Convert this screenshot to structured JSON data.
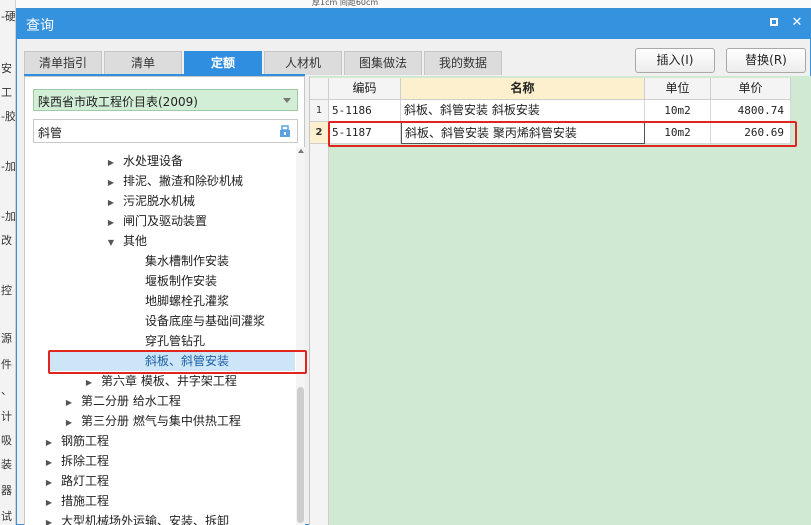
{
  "background": {
    "top_text": "厚1cm 间距60cm",
    "left_fragments": [
      "-硬",
      "安",
      "工",
      "-胶",
      "-加",
      "-加",
      "改",
      "控",
      "源",
      "件",
      "、",
      "计",
      "吸",
      "装",
      "器",
      "试"
    ]
  },
  "dialog": {
    "title": "查询",
    "tabs": [
      "清单指引",
      "清单",
      "定额",
      "人材机",
      "图集做法",
      "我的数据"
    ],
    "active_tab": "定额",
    "buttons": {
      "insert": "插入(I)",
      "replace": "替换(R)"
    }
  },
  "left": {
    "library": "陕西省市政工程价目表(2009)",
    "search_value": "斜管",
    "tree": [
      {
        "label": "水处理设备",
        "toggle": "▶"
      },
      {
        "label": "排泥、撇渣和除砂机械",
        "toggle": "▶"
      },
      {
        "label": "污泥脱水机械",
        "toggle": "▶"
      },
      {
        "label": "闸门及驱动装置",
        "toggle": "▶"
      },
      {
        "label": "其他",
        "toggle": "▼"
      },
      {
        "label": "集水槽制作安装",
        "toggle": ""
      },
      {
        "label": "堰板制作安装",
        "toggle": ""
      },
      {
        "label": "地脚螺栓孔灌浆",
        "toggle": ""
      },
      {
        "label": "设备底座与基础间灌浆",
        "toggle": ""
      },
      {
        "label": "穿孔管钻孔",
        "toggle": ""
      },
      {
        "label": "斜板、斜管安装",
        "toggle": ""
      },
      {
        "label": "第六章 模板、井字架工程",
        "toggle": "▶"
      },
      {
        "label": "第二分册 给水工程",
        "toggle": "▶"
      },
      {
        "label": "第三分册 燃气与集中供热工程",
        "toggle": "▶"
      },
      {
        "label": "钢筋工程",
        "toggle": "▶"
      },
      {
        "label": "拆除工程",
        "toggle": "▶"
      },
      {
        "label": "路灯工程",
        "toggle": "▶"
      },
      {
        "label": "措施工程",
        "toggle": "▶"
      },
      {
        "label": "大型机械场外运输、安装、拆卸",
        "toggle": "▶"
      }
    ]
  },
  "grid": {
    "columns": [
      "编码",
      "名称",
      "单位",
      "单价"
    ],
    "rows": [
      {
        "num": "1",
        "code": "5-1186",
        "name": "斜板、斜管安装 斜板安装",
        "unit": "10m2",
        "price": "4800.74"
      },
      {
        "num": "2",
        "code": "5-1187",
        "name": "斜板、斜管安装 聚丙烯斜管安装",
        "unit": "10m2",
        "price": "260.69"
      }
    ]
  },
  "colors": {
    "title_bar": "#3592df",
    "highlight": "#e0241f",
    "grid_bg": "#cfe9d2"
  }
}
